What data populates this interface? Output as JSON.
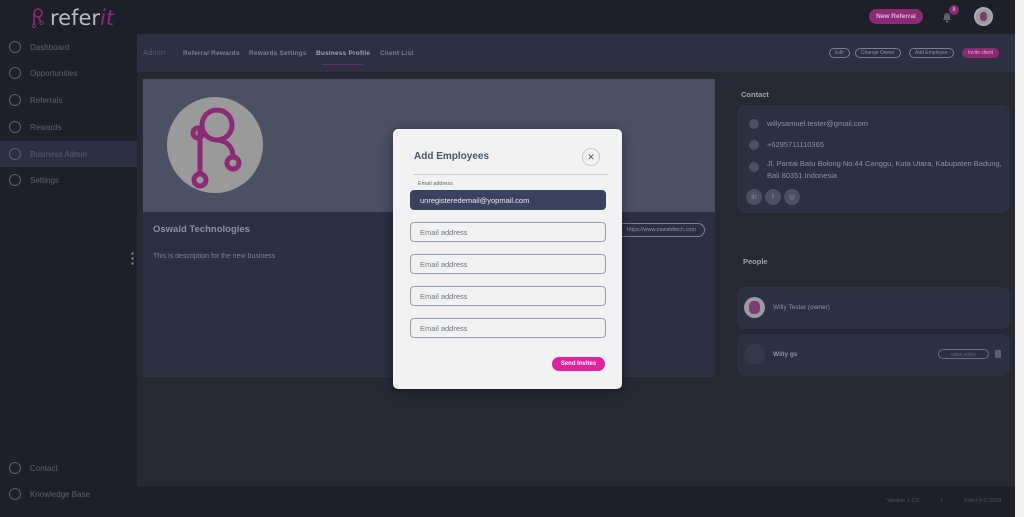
{
  "brand": {
    "name_a": "refer",
    "name_b": "it",
    "accent": "#e2229c"
  },
  "topbar": {
    "new_referral": "New Referral",
    "notification_count": "8"
  },
  "sidebar": {
    "items": [
      {
        "label": "Dashboard",
        "icon": "dashboard-icon"
      },
      {
        "label": "Opportunities",
        "icon": "lightbulb-icon"
      },
      {
        "label": "Referrals",
        "icon": "referrals-icon"
      },
      {
        "label": "Rewards",
        "icon": "rewards-icon"
      },
      {
        "label": "Business Admin",
        "icon": "business-icon",
        "active": true
      },
      {
        "label": "Settings",
        "icon": "gear-icon"
      }
    ],
    "bottom": [
      {
        "label": "Contact",
        "icon": "help-icon"
      },
      {
        "label": "Knowledge Base",
        "icon": "info-icon"
      }
    ]
  },
  "subnav": {
    "section": "Admin",
    "tabs": [
      "Referral Rewards",
      "Rewards Settings",
      "Business Profile",
      "Client List"
    ],
    "active_tab": "Business Profile",
    "actions": {
      "edit": "Edit",
      "change_owner": "Change Owner",
      "add_employee": "Add Employee",
      "invite_client": "Invite client"
    }
  },
  "business": {
    "name": "Oswald Technologies",
    "description": "This is description for the new business",
    "website": "https://www.oswaldtech.com"
  },
  "contact": {
    "title": "Contact",
    "email": "willysamuel.tester@gmail.com",
    "phone": "+6285711110365",
    "address": "Jl. Pantai Batu Bolong No.44 Canggu, Kuta Utara, Kabupaten Badung, Bali 80351 Indonesia"
  },
  "people": {
    "title": "People",
    "items": [
      {
        "name": "Willy Tester (owner)"
      },
      {
        "name": "Willy gs",
        "action": "Make Admin"
      }
    ]
  },
  "footer": {
    "version": "Version 1.0.0",
    "separator": "|",
    "copyright": "Refer It © 2023"
  },
  "modal": {
    "title": "Add Employees",
    "field_label": "Email address",
    "placeholder": "Email address",
    "first_value": "unregisteredemail@yopmail.com",
    "submit": "Send Invites"
  }
}
